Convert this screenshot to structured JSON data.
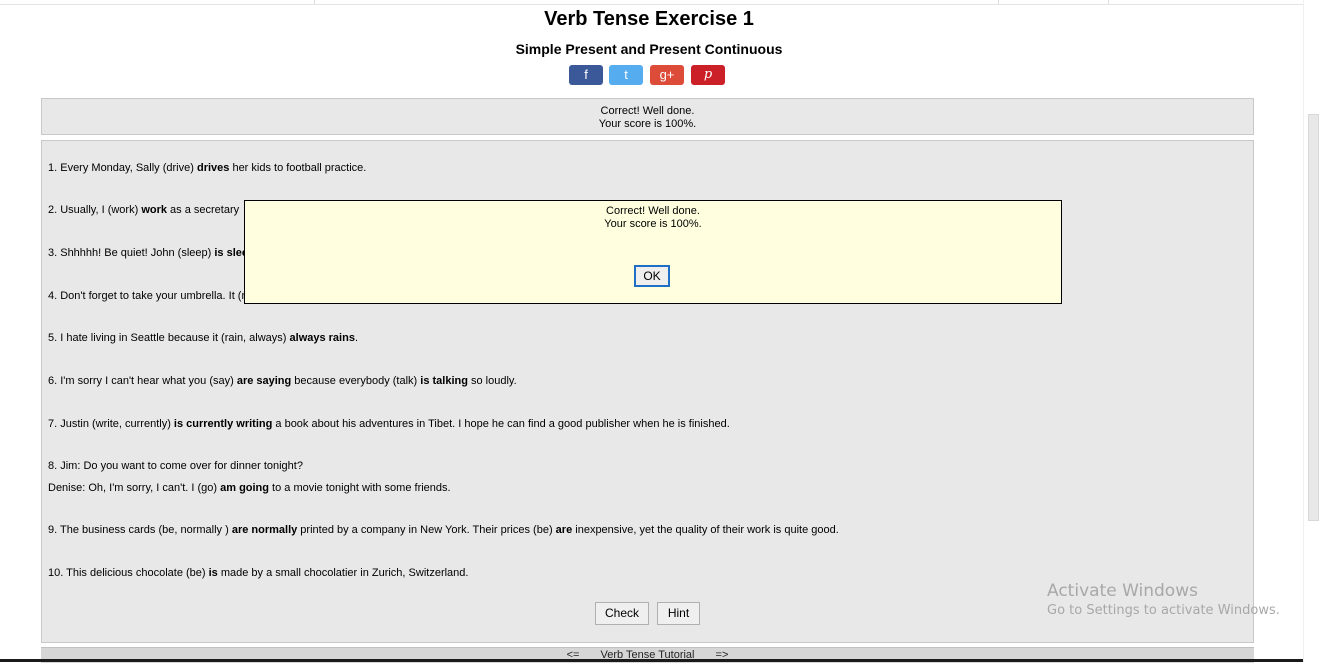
{
  "title": "Verb Tense Exercise 1",
  "subtitle": "Simple Present and Present Continuous",
  "share": {
    "facebook": "f",
    "twitter": "t",
    "google": "g+",
    "pinterest": "p"
  },
  "result": {
    "line1": "Correct! Well done.",
    "line2": "Your score is 100%."
  },
  "questions": [
    {
      "pre": "1. Every Monday, Sally (drive) ",
      "ans": "drives",
      "post": " her kids to football practice."
    },
    {
      "pre": "2. Usually, I (work) ",
      "ans": "work",
      "post": " as a secretary"
    },
    {
      "pre": "3. Shhhhh! Be quiet! John (sleep) ",
      "ans": "is slee",
      "post": ""
    },
    {
      "pre": "4. Don't forget to take your umbrella. It (ra",
      "ans": "",
      "post": ""
    },
    {
      "pre": "5. I hate living in Seattle because it (rain, always) ",
      "ans": "always rains",
      "post": "."
    },
    {
      "pre": "6. I'm sorry I can't hear what you (say) ",
      "ans": "are saying",
      "mid": " because everybody (talk) ",
      "ans2": "is talking",
      "post": " so loudly."
    },
    {
      "pre": "7. Justin (write, currently) ",
      "ans": "is currently writing",
      "post": " a book about his adventures in Tibet. I hope he can find a good publisher when he is finished."
    },
    {
      "pre": "8. Jim: Do you want to come over for dinner tonight?",
      "ans": "",
      "post": ""
    },
    {
      "pre": "Denise: Oh, I'm sorry, I can't. I (go) ",
      "ans": "am going",
      "post": " to a movie tonight with some friends."
    },
    {
      "pre": "9. The business cards (be, normally ) ",
      "ans": "are normally",
      "mid": " printed by a company in New York. Their prices (be) ",
      "ans2": "are",
      "post": " inexpensive, yet the quality of their work is quite good."
    },
    {
      "pre": "10. This delicious chocolate (be) ",
      "ans": "is",
      "post": " made by a small chocolatier in Zurich, Switzerland."
    }
  ],
  "buttons": {
    "check": "Check",
    "hint": "Hint"
  },
  "modal": {
    "line1": "Correct! Well done.",
    "line2": "Your score is 100%.",
    "ok": "OK"
  },
  "nav": {
    "prev": "<=",
    "link": "Verb Tense Tutorial",
    "next": "=>"
  },
  "watermark": {
    "line1": "Activate Windows",
    "line2": "Go to Settings to activate Windows."
  }
}
